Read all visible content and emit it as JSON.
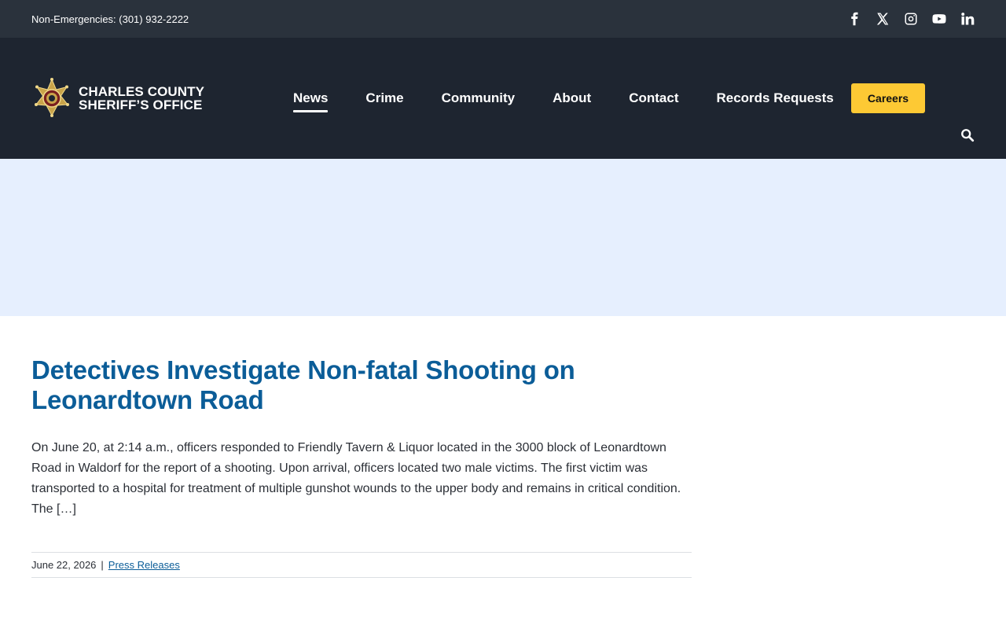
{
  "topbar": {
    "phone_text": "Non-Emergencies: (301) 932-2222",
    "social_icons": [
      "facebook-icon",
      "x-twitter-icon",
      "instagram-icon",
      "youtube-icon",
      "linkedin-icon"
    ]
  },
  "header": {
    "logo_line1": "CHARLES COUNTY",
    "logo_line2": "SHERIFF’S OFFICE",
    "nav": [
      {
        "label": "News",
        "active": true
      },
      {
        "label": "Crime"
      },
      {
        "label": "Community"
      },
      {
        "label": "About"
      },
      {
        "label": "Contact"
      },
      {
        "label": "Records Requests"
      }
    ],
    "careers_label": "Careers",
    "search_icon": "search-icon"
  },
  "post": {
    "title": "Detectives Investigate Non-fatal Shooting on Leonardtown Road",
    "excerpt": "On June 20, at 2:14 a.m., officers responded to Friendly Tavern & Liquor located in the 3000 block of Leonardtown Road in Waldorf for the report of a shooting. Upon arrival, officers located two male victims. The first victim was transported to a hospital for treatment of multiple gunshot wounds to the upper body and remains in critical condition. The […]",
    "date": "June 22, 2026",
    "separator": "|",
    "category": "Press Releases"
  },
  "colors": {
    "topbar_bg": "#2a323c",
    "header_bg": "#1e2530",
    "hero_bg": "#e6effe",
    "accent_gold": "#fdc934",
    "title_blue": "#0b5d98"
  }
}
